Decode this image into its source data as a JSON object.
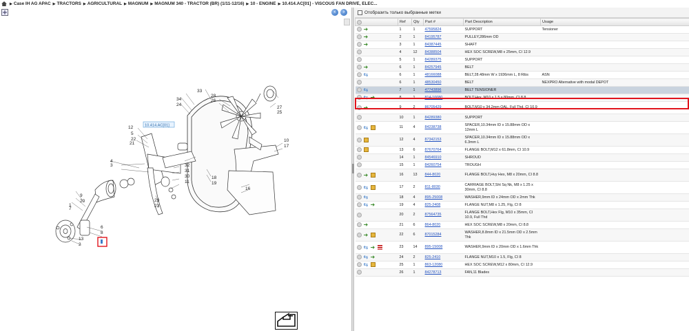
{
  "breadcrumb": {
    "items": [
      "Case IH AG APAC",
      "TRACTORS",
      "AGRICULTURAL",
      "MAGNUM",
      "MAGNUM 340 - TRACTOR (BR) (1/11-12/16)",
      "10 - ENGINE",
      "10.414.AC[01] - VISCOUS FAN DRIVE, ELEC..."
    ]
  },
  "diagram": {
    "tag_label": "10.414.AC[01]",
    "refs": [
      "1",
      "2",
      "3",
      "4",
      "5",
      "6",
      "7",
      "8",
      "9",
      "10",
      "11",
      "12",
      "13",
      "16",
      "17",
      "18",
      "19",
      "20",
      "21",
      "22",
      "23",
      "24",
      "25",
      "26",
      "27",
      "28",
      "29",
      "30",
      "31",
      "32",
      "33",
      "34"
    ]
  },
  "filter": {
    "label": "Отобразить только выбранные метки"
  },
  "table": {
    "headers": [
      "",
      "Ref",
      "Qty",
      "Part #",
      "Part Description",
      "Usage"
    ],
    "rows": [
      {
        "icons": [
          "circle",
          "arrow"
        ],
        "ref": "1",
        "qty": "1",
        "part": "47595824",
        "desc": "SUPPORT",
        "usage": "Tensioner"
      },
      {
        "icons": [
          "circle",
          "arrow"
        ],
        "ref": "2",
        "qty": "1",
        "part": "84195787",
        "desc": "PULLEY,286mm OD",
        "usage": ""
      },
      {
        "icons": [
          "circle",
          "arrow"
        ],
        "ref": "3",
        "qty": "1",
        "part": "84387445",
        "desc": "SHAFT",
        "usage": ""
      },
      {
        "icons": [
          "circle"
        ],
        "ref": "4",
        "qty": "12",
        "part": "84388504",
        "desc": "HEX SOC SCREW,M8 x 25mm, CI 12.9",
        "usage": ""
      },
      {
        "icons": [
          "circle"
        ],
        "ref": "5",
        "qty": "1",
        "part": "84289375",
        "desc": "SUPPORT",
        "usage": ""
      },
      {
        "icons": [
          "circle",
          "arrow"
        ],
        "ref": "6",
        "qty": "1",
        "part": "84257945",
        "desc": "BELT",
        "usage": ""
      },
      {
        "icons": [
          "circle",
          "swap"
        ],
        "ref": "6",
        "qty": "1",
        "part": "48166088",
        "desc": "BELT,28.48mm W x 1936mm L, 8 Ribs",
        "usage": "ASN"
      },
      {
        "icons": [
          "circle"
        ],
        "ref": "6",
        "qty": "1",
        "part": "48530450",
        "desc": "BELT",
        "usage": "NEXPRO Alternative with modal DEPOT"
      },
      {
        "icons": [
          "circle",
          "swap"
        ],
        "ref": "7",
        "qty": "1",
        "part": "47743896",
        "desc": "BELT TENSIONER",
        "usage": "",
        "selected": true
      },
      {
        "icons": [
          "circle",
          "swap",
          "arrow"
        ],
        "ref": "8",
        "qty": "1",
        "part": "814-10080",
        "desc": "BOLT,Hex, M10 x 1.5 x 80mm, CI 8.8",
        "usage": ""
      },
      {
        "icons": [
          "circle",
          "arrow"
        ],
        "ref": "9",
        "qty": "2",
        "part": "86705429",
        "desc": "BOLT,M10 x 34.2mm OAL, Full Thd, CI 10.9",
        "usage": "",
        "tall": true
      },
      {
        "icons": [
          "circle"
        ],
        "ref": "10",
        "qty": "1",
        "part": "84289380",
        "desc": "SUPPORT",
        "usage": ""
      },
      {
        "icons": [
          "circle",
          "swap",
          "box"
        ],
        "ref": "11",
        "qty": "4",
        "part": "84238738",
        "desc": "SPACER,10.34mm ID x 15.88mm OD x 12mm L",
        "usage": "",
        "tall": true
      },
      {
        "icons": [
          "circle",
          "box"
        ],
        "ref": "12",
        "qty": "4",
        "part": "87342153",
        "desc": "SPACER,10.34mm ID x 15.88mm OD x 6.3mm L",
        "usage": "",
        "tall": true
      },
      {
        "icons": [
          "circle",
          "box"
        ],
        "ref": "13",
        "qty": "6",
        "part": "87670764",
        "desc": "FLANGE BOLT,M12 x 61.8mm, CI 10.9",
        "usage": ""
      },
      {
        "icons": [
          "circle"
        ],
        "ref": "14",
        "qty": "1",
        "part": "84546910",
        "desc": "SHROUD",
        "usage": ""
      },
      {
        "icons": [
          "circle"
        ],
        "ref": "15",
        "qty": "1",
        "part": "84260754",
        "desc": "TROUGH",
        "usage": ""
      },
      {
        "icons": [
          "circle",
          "arrow",
          "box"
        ],
        "ref": "16",
        "qty": "13",
        "part": "844-8020",
        "desc": "FLANGE BOLT,Hvy Hex, M8 x 20mm, CI 8.8",
        "usage": "",
        "tall": true
      },
      {
        "icons": [
          "circle",
          "swap",
          "box"
        ],
        "ref": "17",
        "qty": "2",
        "part": "811-8030",
        "desc": "CARRIAGE BOLT,Sht Sq Nk, M8 x 1.25 x 30mm, CI 8.8",
        "usage": "",
        "tall": true
      },
      {
        "icons": [
          "circle",
          "swap"
        ],
        "ref": "18",
        "qty": "4",
        "part": "895-25008",
        "desc": "WASHER,9mm ID x 24mm OD x 2mm Thk",
        "usage": ""
      },
      {
        "icons": [
          "circle",
          "swap",
          "arrow"
        ],
        "ref": "19",
        "qty": "4",
        "part": "825-2408",
        "desc": "FLANGE NUT,M8 x 1.25, Flg, CI 8",
        "usage": ""
      },
      {
        "icons": [
          "circle"
        ],
        "ref": "20",
        "qty": "2",
        "part": "87564735",
        "desc": "FLANGE BOLT,Hex Flg, M10 x 35mm, CI 10.9, Full Thd",
        "usage": "",
        "tall": true
      },
      {
        "icons": [
          "circle",
          "arrow"
        ],
        "ref": "21",
        "qty": "6",
        "part": "864-8020",
        "desc": "HEX SOC SCREW,M8 x 20mm, CI 8.8",
        "usage": ""
      },
      {
        "icons": [
          "circle",
          "arrow",
          "box"
        ],
        "ref": "22",
        "qty": "6",
        "part": "87015284",
        "desc": "WASHER,8.8mm ID x 21.5mm OD x 2.5mm Thk",
        "usage": "",
        "tall": true
      },
      {
        "icons": [
          "circle",
          "swap",
          "arrow",
          "flag"
        ],
        "ref": "23",
        "qty": "14",
        "part": "895-15008",
        "desc": "WASHER,9mm ID x 20mm OD x 1.6mm Thk",
        "usage": "",
        "tall": true
      },
      {
        "icons": [
          "circle",
          "swap",
          "arrow"
        ],
        "ref": "24",
        "qty": "2",
        "part": "825-2410",
        "desc": "FLANGE NUT,M10 x 1.5, Flg, CI 8",
        "usage": ""
      },
      {
        "icons": [
          "circle",
          "swap",
          "box"
        ],
        "ref": "25",
        "qty": "1",
        "part": "863-12080",
        "desc": "HEX SOC SCREW,M12 x 80mm, CI 12.9",
        "usage": ""
      },
      {
        "icons": [
          "circle"
        ],
        "ref": "26",
        "qty": "1",
        "part": "84278713",
        "desc": "FAN,11 Blades",
        "usage": ""
      }
    ]
  },
  "colors": {
    "link": "#1f4fbf",
    "highlight": "#e0141c",
    "selected_row": "#c9d3de"
  }
}
